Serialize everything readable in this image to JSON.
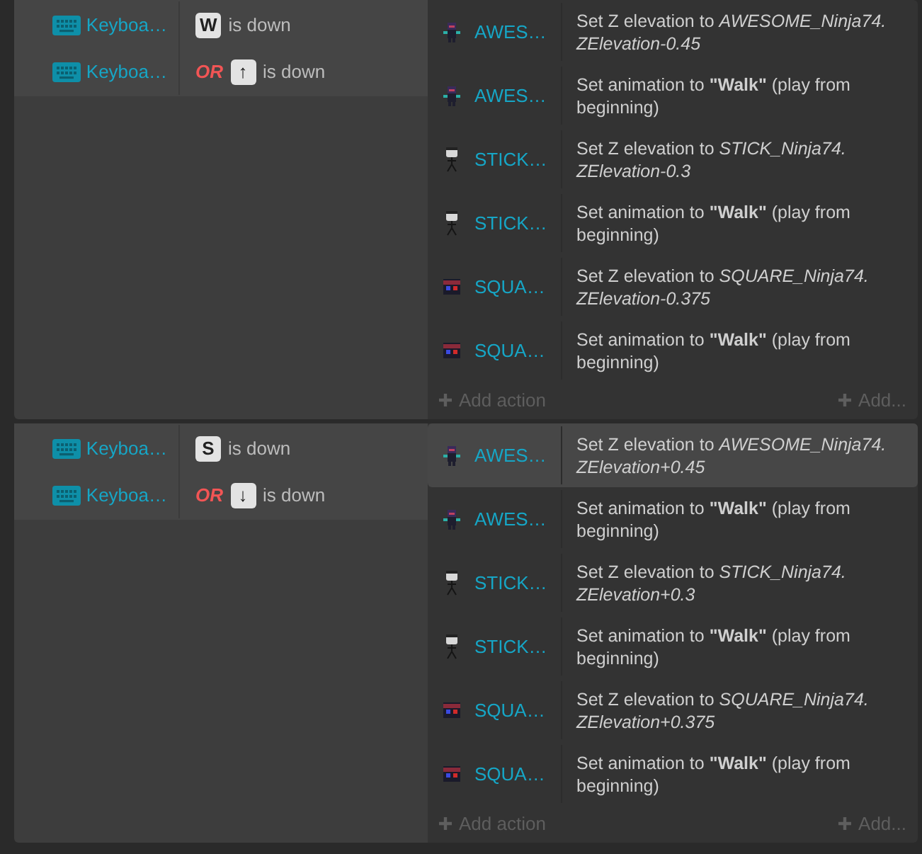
{
  "events": [
    {
      "conditions": [
        {
          "object": "Keyboa…",
          "key": "W",
          "text": "is down"
        },
        {
          "object": "Keyboa…",
          "or_label": "OR",
          "key": "↑",
          "text": "is down"
        }
      ],
      "actions": [
        {
          "kind": "ninja",
          "object": "AWES…",
          "text": "Set Z elevation to *AWESOME_Ninja74. ZElevation-0.45*",
          "selected": false
        },
        {
          "kind": "ninja",
          "object": "AWES…",
          "text": "Set animation to **\"Walk\"** (play from beginning)",
          "selected": false
        },
        {
          "kind": "stick",
          "object": "STICK…",
          "text": "Set Z elevation to *STICK_Ninja74. ZElevation-0.3*",
          "selected": false
        },
        {
          "kind": "stick",
          "object": "STICK…",
          "text": "Set animation to **\"Walk\"** (play from beginning)",
          "selected": false
        },
        {
          "kind": "square",
          "object": "SQUA…",
          "text": "Set Z elevation to *SQUARE_Ninja74. ZElevation-0.375*",
          "selected": false
        },
        {
          "kind": "square",
          "object": "SQUA…",
          "text": "Set animation to **\"Walk\"** (play from beginning)",
          "selected": false
        }
      ],
      "add_action": "Add action",
      "add_other": "Add..."
    },
    {
      "conditions": [
        {
          "object": "Keyboa…",
          "key": "S",
          "text": "is down"
        },
        {
          "object": "Keyboa…",
          "or_label": "OR",
          "key": "↓",
          "text": "is down"
        }
      ],
      "actions": [
        {
          "kind": "ninja",
          "object": "AWES…",
          "text": "Set Z elevation to *AWESOME_Ninja74. ZElevation+0.45*",
          "selected": true
        },
        {
          "kind": "ninja",
          "object": "AWES…",
          "text": "Set animation to **\"Walk\"** (play from beginning)",
          "selected": false
        },
        {
          "kind": "stick",
          "object": "STICK…",
          "text": "Set Z elevation to *STICK_Ninja74. ZElevation+0.3*",
          "selected": false
        },
        {
          "kind": "stick",
          "object": "STICK…",
          "text": "Set animation to **\"Walk\"** (play from beginning)",
          "selected": false
        },
        {
          "kind": "square",
          "object": "SQUA…",
          "text": "Set Z elevation to *SQUARE_Ninja74. ZElevation+0.375*",
          "selected": false
        },
        {
          "kind": "square",
          "object": "SQUA…",
          "text": "Set animation to **\"Walk\"** (play from beginning)",
          "selected": false
        }
      ],
      "add_action": "Add action",
      "add_other": "Add..."
    }
  ]
}
